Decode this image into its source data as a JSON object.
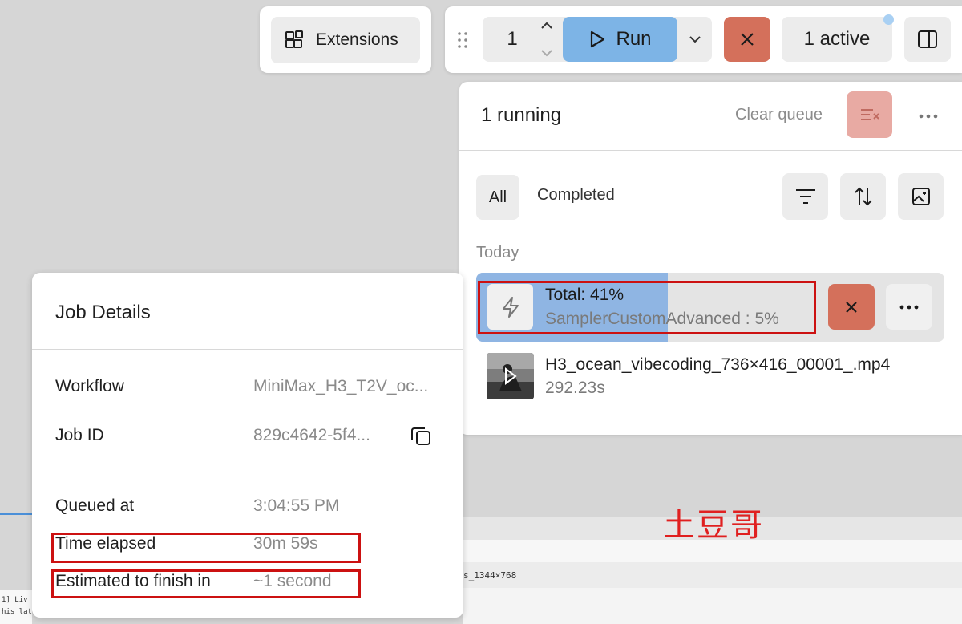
{
  "extensions": {
    "label": "Extensions"
  },
  "toolbar": {
    "batch_count": "1",
    "run_label": "Run",
    "active_label": "1 active"
  },
  "queue": {
    "running_label": "1 running",
    "clear_label": "Clear queue",
    "tabs": [
      {
        "label": "All",
        "selected": true
      },
      {
        "label": "Completed",
        "selected": false
      }
    ],
    "section_today": "Today",
    "running_job": {
      "total": "Total: 41%",
      "node": "SamplerCustomAdvanced : 5%",
      "progress_percent": 41
    },
    "completed_job": {
      "name": "H3_ocean_vibecoding_736×416_00001_.mp4",
      "duration": "292.23s"
    }
  },
  "job_details": {
    "title": "Job Details",
    "fields": [
      {
        "label": "Workflow",
        "value": "MiniMax_H3_T2V_oc..."
      },
      {
        "label": "Job ID",
        "value": "829c4642-5f4..."
      },
      {
        "label": "Queued at",
        "value": "3:04:55 PM"
      },
      {
        "label": "Time elapsed",
        "value": "30m 59s"
      },
      {
        "label": "Estimated to finish in",
        "value": "~1 second"
      }
    ]
  },
  "background": {
    "filename_fragment": "s_1344×768",
    "log_lines": [
      "1] Liv",
      "his late"
    ]
  },
  "watermark": "土豆哥",
  "colors": {
    "run_button": "#7db4e6",
    "stop_button": "#d4705b",
    "highlight_box": "#cc1111",
    "progress_fill": "#8fb5e3",
    "watermark": "#e02020"
  }
}
